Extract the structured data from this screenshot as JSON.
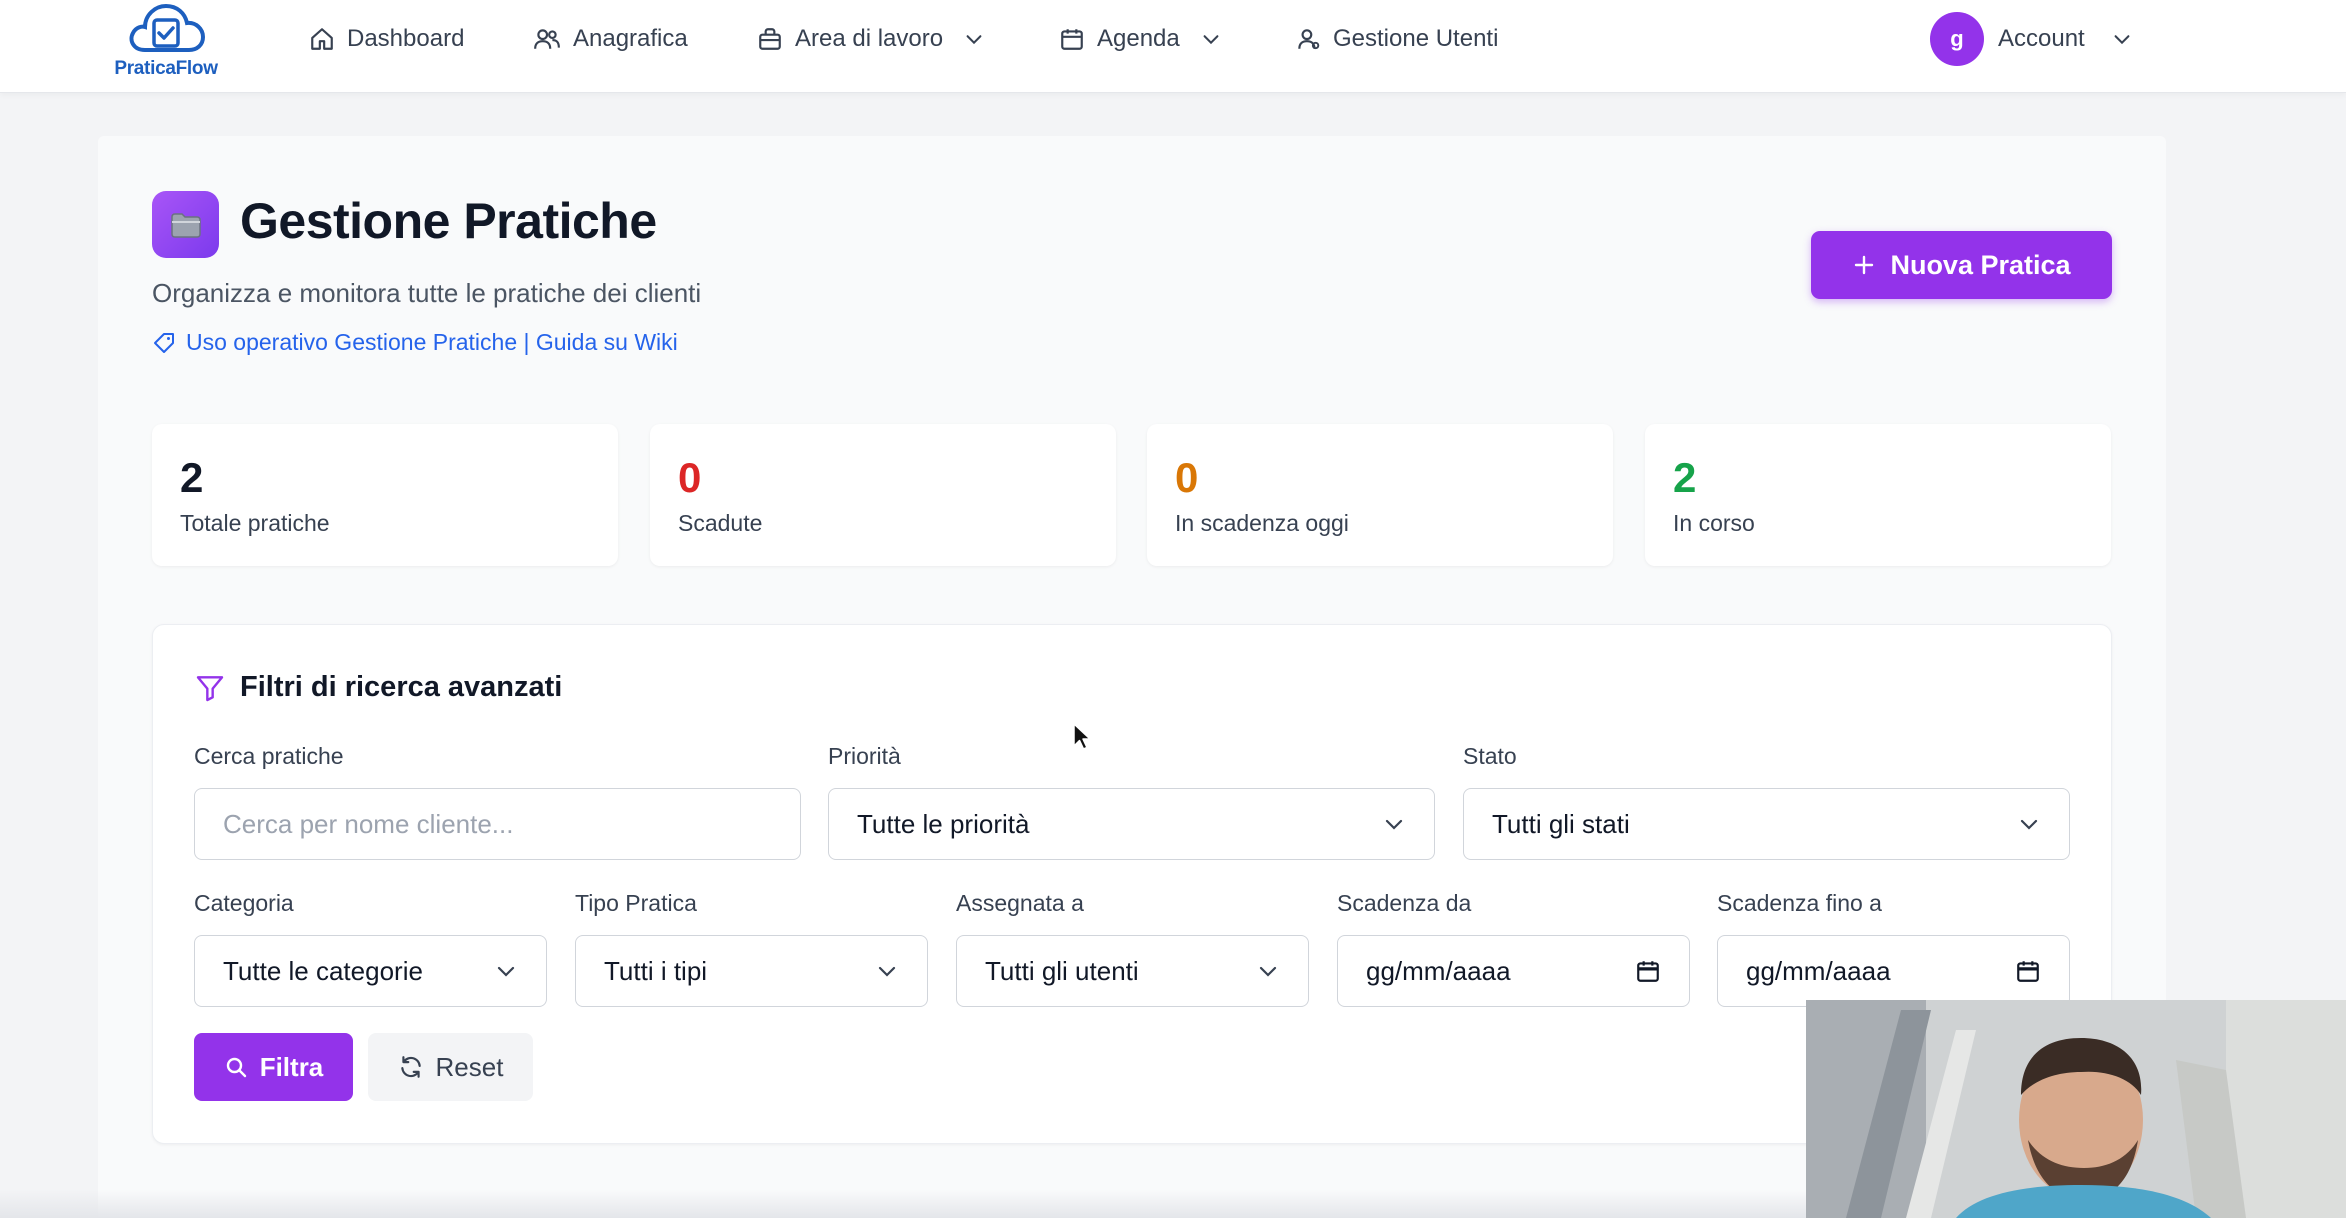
{
  "brand": {
    "name": "PraticaFlow",
    "color": "#1d5fbf"
  },
  "nav": {
    "items": [
      {
        "label": "Dashboard",
        "icon": "home-icon"
      },
      {
        "label": "Anagrafica",
        "icon": "users-icon"
      },
      {
        "label": "Area di lavoro",
        "icon": "briefcase-icon",
        "dropdown": true
      },
      {
        "label": "Agenda",
        "icon": "calendar-icon",
        "dropdown": true
      },
      {
        "label": "Gestione Utenti",
        "icon": "user-cog-icon"
      }
    ],
    "account": {
      "initial": "g",
      "label": "Account"
    }
  },
  "header": {
    "title": "Gestione Pratiche",
    "subtitle": "Organizza e monitora tutte le pratiche dei clienti",
    "wiki_link": "Uso operativo Gestione Pratiche | Guida su Wiki",
    "new_button": "Nuova Pratica"
  },
  "stats": [
    {
      "value": "2",
      "label": "Totale pratiche",
      "color": "#111827"
    },
    {
      "value": "0",
      "label": "Scadute",
      "color": "#dc2626"
    },
    {
      "value": "0",
      "label": "In scadenza oggi",
      "color": "#d97706"
    },
    {
      "value": "2",
      "label": "In corso",
      "color": "#16a34a"
    }
  ],
  "filters": {
    "title": "Filtri di ricerca avanzati",
    "search": {
      "label": "Cerca pratiche",
      "placeholder": "Cerca per nome cliente..."
    },
    "priority": {
      "label": "Priorità",
      "value": "Tutte le priorità"
    },
    "status": {
      "label": "Stato",
      "value": "Tutti gli stati"
    },
    "category": {
      "label": "Categoria",
      "value": "Tutte le categorie"
    },
    "type": {
      "label": "Tipo Pratica",
      "value": "Tutti i tipi"
    },
    "assigned": {
      "label": "Assegnata a",
      "value": "Tutti gli utenti"
    },
    "due_from": {
      "label": "Scadenza da",
      "placeholder": "gg/mm/aaaa"
    },
    "due_to": {
      "label": "Scadenza fino a",
      "placeholder": "gg/mm/aaaa"
    },
    "filter_button": "Filtra",
    "reset_button": "Reset"
  },
  "colors": {
    "accent": "#9333ea",
    "link": "#2563eb"
  }
}
